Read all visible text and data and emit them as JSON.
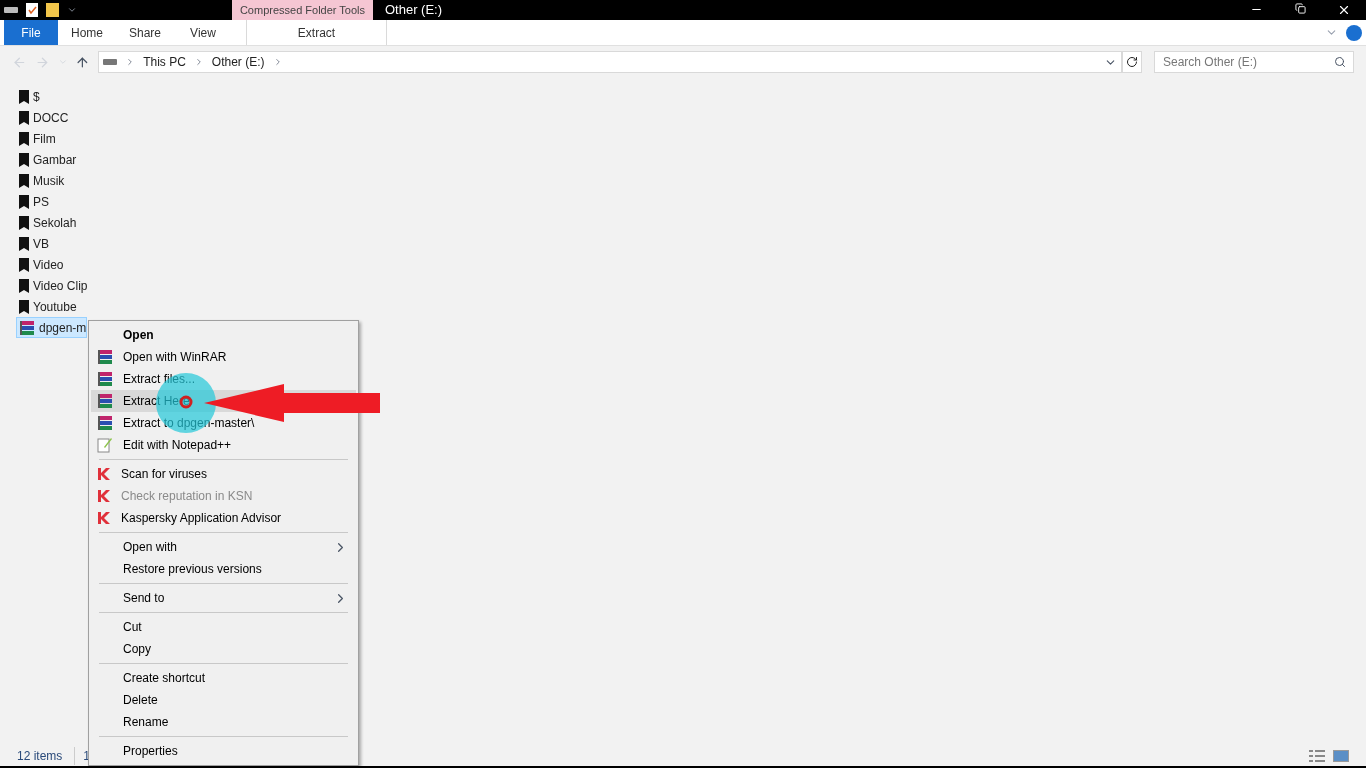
{
  "window": {
    "context_tab": "Compressed Folder Tools",
    "title": "Other (E:)"
  },
  "ribbon": {
    "tabs": [
      {
        "label": "File",
        "kind": "file"
      },
      {
        "label": "Home",
        "kind": "tab"
      },
      {
        "label": "Share",
        "kind": "tab"
      },
      {
        "label": "View",
        "kind": "tab"
      },
      {
        "label": "Extract",
        "kind": "context"
      }
    ]
  },
  "address": {
    "crumbs": [
      "This PC",
      "Other (E:)"
    ]
  },
  "search": {
    "placeholder": "Search Other (E:)"
  },
  "files": [
    {
      "name": "$",
      "kind": "folder",
      "selected": false
    },
    {
      "name": "DOCC",
      "kind": "folder",
      "selected": false
    },
    {
      "name": "Film",
      "kind": "folder",
      "selected": false
    },
    {
      "name": "Gambar",
      "kind": "folder",
      "selected": false
    },
    {
      "name": "Musik",
      "kind": "folder",
      "selected": false
    },
    {
      "name": "PS",
      "kind": "folder",
      "selected": false
    },
    {
      "name": "Sekolah",
      "kind": "folder",
      "selected": false
    },
    {
      "name": "VB",
      "kind": "folder",
      "selected": false
    },
    {
      "name": "Video",
      "kind": "folder",
      "selected": false
    },
    {
      "name": "Video Clip",
      "kind": "folder",
      "selected": false
    },
    {
      "name": "Youtube",
      "kind": "folder",
      "selected": false
    },
    {
      "name": "dpgen-m",
      "kind": "archive",
      "selected": true
    }
  ],
  "context_menu": {
    "sections": [
      [
        {
          "label": "Open",
          "kind": "plain",
          "bold": true,
          "disabled": false,
          "submenu": false,
          "selected": false
        },
        {
          "label": "Open with WinRAR",
          "kind": "archiver",
          "bold": false,
          "disabled": false,
          "submenu": false,
          "selected": false
        },
        {
          "label": "Extract files...",
          "kind": "archiver",
          "bold": false,
          "disabled": false,
          "submenu": false,
          "selected": false
        },
        {
          "label": "Extract Here",
          "kind": "archiver",
          "bold": false,
          "disabled": false,
          "submenu": false,
          "selected": true
        },
        {
          "label": "Extract to dpgen-master\\",
          "kind": "archiver",
          "bold": false,
          "disabled": false,
          "submenu": false,
          "selected": false
        },
        {
          "label": "Edit with Notepad++",
          "kind": "editor",
          "bold": false,
          "disabled": false,
          "submenu": false,
          "selected": false
        }
      ],
      [
        {
          "label": "Scan for viruses",
          "kind": "antivirus",
          "bold": false,
          "disabled": false,
          "submenu": false,
          "selected": false
        },
        {
          "label": "Check reputation in KSN",
          "kind": "antivirus",
          "bold": false,
          "disabled": true,
          "submenu": false,
          "selected": false
        },
        {
          "label": "Kaspersky Application Advisor",
          "kind": "antivirus",
          "bold": false,
          "disabled": false,
          "submenu": false,
          "selected": false
        }
      ],
      [
        {
          "label": "Open with",
          "kind": "plain",
          "bold": false,
          "disabled": false,
          "submenu": true,
          "selected": false
        },
        {
          "label": "Restore previous versions",
          "kind": "plain",
          "bold": false,
          "disabled": false,
          "submenu": false,
          "selected": false
        }
      ],
      [
        {
          "label": "Send to",
          "kind": "plain",
          "bold": false,
          "disabled": false,
          "submenu": true,
          "selected": false
        }
      ],
      [
        {
          "label": "Cut",
          "kind": "plain",
          "bold": false,
          "disabled": false,
          "submenu": false,
          "selected": false
        },
        {
          "label": "Copy",
          "kind": "plain",
          "bold": false,
          "disabled": false,
          "submenu": false,
          "selected": false
        }
      ],
      [
        {
          "label": "Create shortcut",
          "kind": "plain",
          "bold": false,
          "disabled": false,
          "submenu": false,
          "selected": false
        },
        {
          "label": "Delete",
          "kind": "plain",
          "bold": false,
          "disabled": false,
          "submenu": false,
          "selected": false
        },
        {
          "label": "Rename",
          "kind": "plain",
          "bold": false,
          "disabled": false,
          "submenu": false,
          "selected": false
        }
      ],
      [
        {
          "label": "Properties",
          "kind": "plain",
          "bold": false,
          "disabled": false,
          "submenu": false,
          "selected": false
        }
      ]
    ]
  },
  "status_bar": {
    "count": "12 items",
    "selection": "1"
  }
}
